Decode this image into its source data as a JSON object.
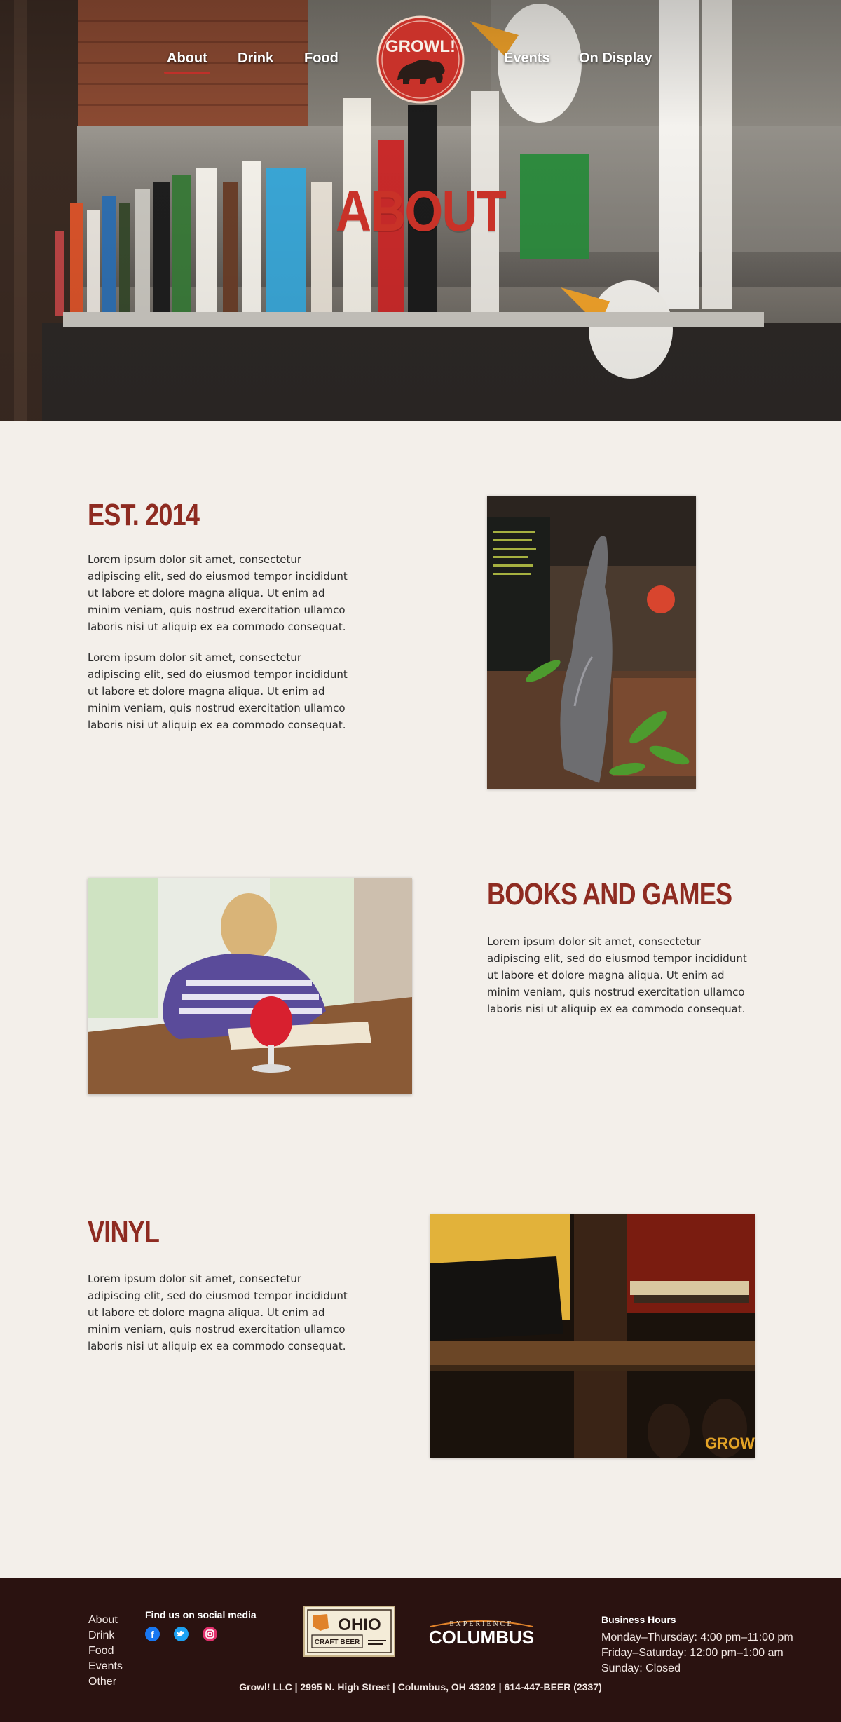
{
  "nav": {
    "items": [
      {
        "label": "About",
        "active": true
      },
      {
        "label": "Drink"
      },
      {
        "label": "Food"
      },
      {
        "label": "Events"
      },
      {
        "label": "On Display"
      }
    ],
    "logo_text": "GROWL!"
  },
  "hero": {
    "title": "ABOUT"
  },
  "sections": [
    {
      "title": "EST. 2014",
      "paragraphs": [
        "Lorem ipsum dolor sit amet, consectetur adipiscing elit, sed do eiusmod tempor incididunt ut labore et dolore magna aliqua. Ut enim ad minim veniam, quis nostrud exercitation ullamco laboris nisi ut aliquip ex ea commodo consequat.",
        "Lorem ipsum dolor sit amet, consectetur adipiscing elit, sed do eiusmod tempor incididunt ut labore et dolore magna aliqua. Ut enim ad minim veniam, quis nostrud exercitation ullamco laboris nisi ut aliquip ex ea commodo consequat."
      ]
    },
    {
      "title": "BOOKS AND GAMES",
      "paragraphs": [
        "Lorem ipsum dolor sit amet, consectetur adipiscing elit, sed do eiusmod tempor incididunt ut labore et dolore magna aliqua. Ut enim ad minim veniam, quis nostrud exercitation ullamco laboris nisi ut aliquip ex ea commodo consequat."
      ]
    },
    {
      "title": "VINYL",
      "paragraphs": [
        "Lorem ipsum dolor sit amet, consectetur adipiscing elit, sed do eiusmod tempor incididunt ut labore et dolore magna aliqua. Ut enim ad minim veniam, quis nostrud exercitation ullamco laboris nisi ut aliquip ex ea commodo consequat."
      ]
    }
  ],
  "footer": {
    "links": [
      "About",
      "Drink",
      "Food",
      "Events",
      "Other"
    ],
    "social_title": "Find us on social media",
    "social_icons": [
      "facebook-icon",
      "twitter-icon",
      "instagram-icon"
    ],
    "ohio_badge": {
      "line1": "OHIO",
      "line2": "CRAFT BEER"
    },
    "columbus_badge": {
      "line1": "EXPERIENCE",
      "line2": "COLUMBUS"
    },
    "hours_title": "Business Hours",
    "hours": [
      "Monday–Thursday: 4:00 pm–11:00 pm",
      "Friday–Saturday: 12:00 pm–1:00 am",
      "Sunday: Closed"
    ],
    "address": "Growl! LLC | 2995 N. High Street | Columbus, OH 43202 | 614-447-BEER (2337)"
  },
  "colors": {
    "accent_red": "#c93228",
    "heading_red": "#8e2b21",
    "page_bg": "#f3efea",
    "footer_bg": "#2a1210"
  }
}
